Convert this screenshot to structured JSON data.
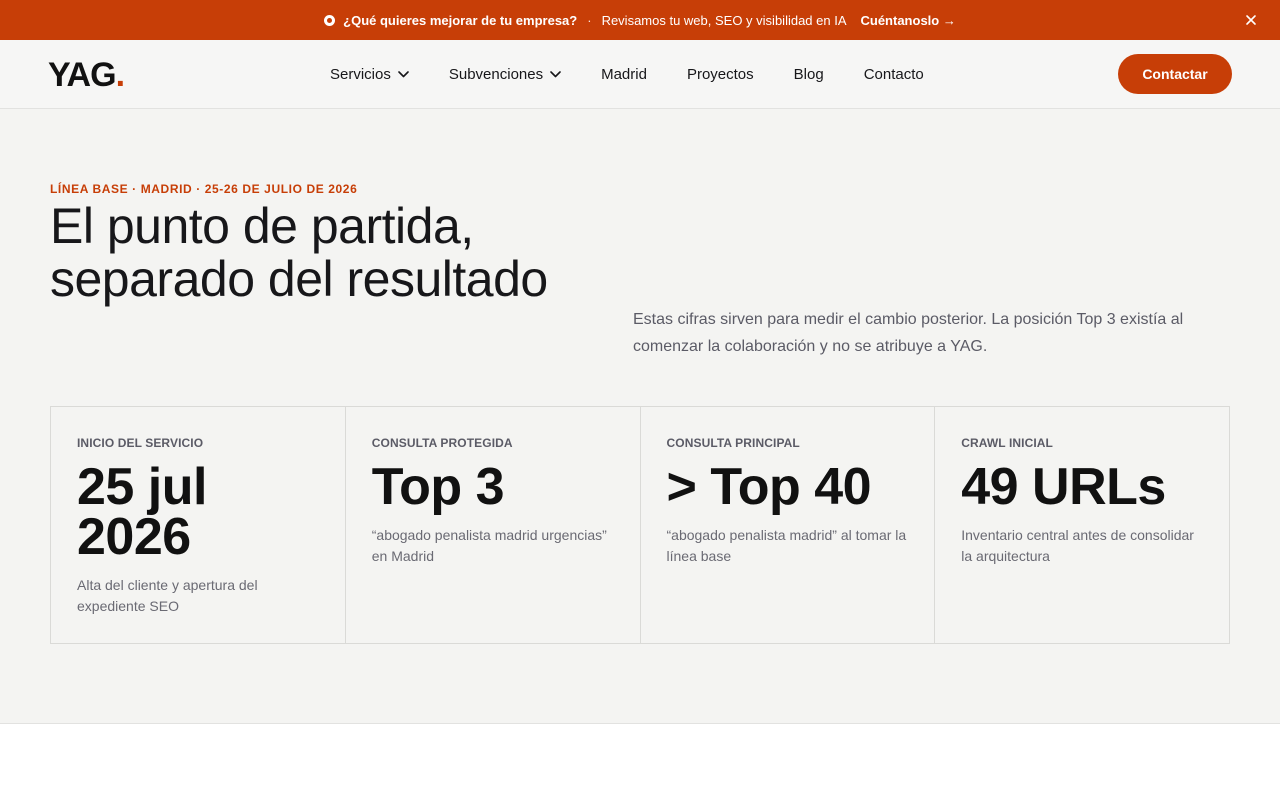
{
  "promo": {
    "question": "¿Qué quieres mejorar de tu empresa?",
    "separator": "·",
    "text": "Revisamos tu web, SEO y visibilidad en IA",
    "cta": "Cuéntanoslo →",
    "close_icon": "close-icon"
  },
  "nav": {
    "logo": "YAG",
    "logo_dot": ".",
    "items": [
      {
        "label": "Servicios",
        "has_dropdown": true
      },
      {
        "label": "Subvenciones",
        "has_dropdown": true
      },
      {
        "label": "Madrid",
        "has_dropdown": false
      },
      {
        "label": "Proyectos",
        "has_dropdown": false
      },
      {
        "label": "Blog",
        "has_dropdown": false
      },
      {
        "label": "Contacto",
        "has_dropdown": false
      }
    ],
    "contact_button": "Contactar"
  },
  "hero": {
    "eyebrow": "LÍNEA BASE · MADRID · 25-26 DE JULIO DE 2026",
    "title": "El punto de partida, separado del resultado",
    "lead": "Estas cifras sirven para medir el cambio posterior. La posición Top 3 existía al comenzar la colaboración y no se atribuye a YAG.",
    "stats": [
      {
        "label": "INICIO DEL SERVICIO",
        "value": "25 jul 2026",
        "desc": "Alta del cliente y apertura del expediente SEO"
      },
      {
        "label": "CONSULTA PROTEGIDA",
        "value": "Top 3",
        "desc": "“abogado penalista madrid urgencias” en Madrid"
      },
      {
        "label": "CONSULTA PRINCIPAL",
        "value": "> Top 40",
        "desc": "“abogado penalista madrid” al tomar la línea base"
      },
      {
        "label": "CRAWL INICIAL",
        "value": "49 URLs",
        "desc": "Inventario central antes de consolidar la arquitectura"
      }
    ]
  },
  "colors": {
    "accent": "#c73e07",
    "hero_bg": "#f4f4f2",
    "nav_bg": "#f6f6f5"
  }
}
